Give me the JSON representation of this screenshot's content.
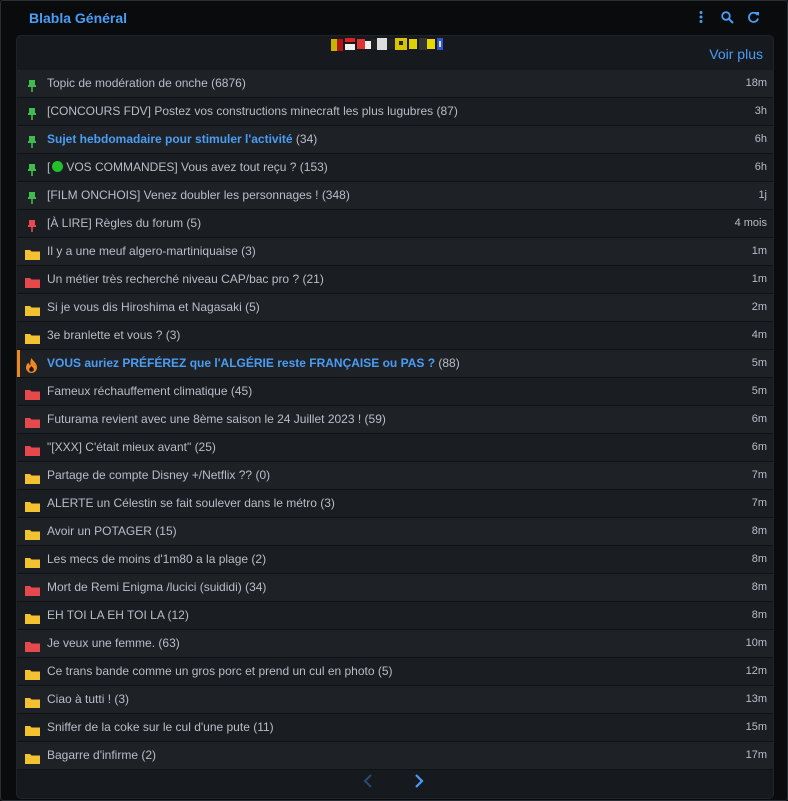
{
  "header": {
    "title": "Blabla Général",
    "icons": [
      "more-vertical-icon",
      "search-icon",
      "refresh-icon"
    ]
  },
  "panel": {
    "voir_plus": "Voir plus"
  },
  "colors": {
    "accent": "#4a9df5",
    "pin_green": "#3fb950",
    "pin_red": "#e5484d",
    "folder_yellow": "#f2c230",
    "folder_red": "#e5484d",
    "hot": "#f0881d",
    "green_dot": "#22c02a"
  },
  "topics": [
    {
      "icon": "pin-green",
      "title": "Topic de modération de onche",
      "count": "(6876)",
      "time": "18m",
      "highlight": false
    },
    {
      "icon": "pin-green",
      "title": "[CONCOURS FDV] Postez vos constructions minecraft les plus lugubres",
      "count": "(87)",
      "time": "3h",
      "highlight": false
    },
    {
      "icon": "pin-green",
      "title": "Sujet hebdomadaire pour stimuler l'activité",
      "count": "(34)",
      "time": "6h",
      "highlight": true
    },
    {
      "icon": "pin-green",
      "title_prefix": "[",
      "title": "VOS COMMANDES] Vous avez tout reçu ?",
      "count": "(153)",
      "time": "6h",
      "highlight": false,
      "dot": true
    },
    {
      "icon": "pin-green",
      "title": "[FILM ONCHOIS] Venez doubler les personnages !",
      "count": "(348)",
      "time": "1j",
      "highlight": false
    },
    {
      "icon": "pin-red",
      "title": "[À LIRE] Règles du forum",
      "count": "(5)",
      "time": "4 mois",
      "highlight": false
    },
    {
      "icon": "folder-yellow",
      "title": "Il y a une meuf algero-martiniquaise",
      "count": "(3)",
      "time": "1m",
      "highlight": false
    },
    {
      "icon": "folder-red",
      "title": "Un métier très recherché niveau CAP/bac pro ?",
      "count": "(21)",
      "time": "1m",
      "highlight": false
    },
    {
      "icon": "folder-yellow",
      "title": "Si je vous dis Hiroshima et Nagasaki",
      "count": "(5)",
      "time": "2m",
      "highlight": false
    },
    {
      "icon": "folder-yellow",
      "title": "3e branlette et vous ?",
      "count": "(3)",
      "time": "4m",
      "highlight": false
    },
    {
      "icon": "flame",
      "title": "VOUS auriez PRÉFÉREZ que l'ALGÉRIE reste FRANÇAISE ou PAS ?",
      "count": "(88)",
      "time": "5m",
      "highlight": true,
      "hot": true
    },
    {
      "icon": "folder-red",
      "title": "Fameux réchauffement climatique",
      "count": "(45)",
      "time": "5m",
      "highlight": false
    },
    {
      "icon": "folder-red",
      "title": "Futurama revient avec une 8ème saison le 24 Juillet 2023 !",
      "count": "(59)",
      "time": "6m",
      "highlight": false
    },
    {
      "icon": "folder-red",
      "title": "\"[XXX] C'était mieux avant\"",
      "count": "(25)",
      "time": "6m",
      "highlight": false
    },
    {
      "icon": "folder-yellow",
      "title": "Partage de compte Disney +/Netflix ??",
      "count": "(0)",
      "time": "7m",
      "highlight": false
    },
    {
      "icon": "folder-yellow",
      "title": "ALERTE un Célestin se fait soulever dans le métro",
      "count": "(3)",
      "time": "7m",
      "highlight": false
    },
    {
      "icon": "folder-yellow",
      "title": "Avoir un POTAGER",
      "count": "(15)",
      "time": "8m",
      "highlight": false
    },
    {
      "icon": "folder-yellow",
      "title": "Les mecs de moins d'1m80 a la plage",
      "count": "(2)",
      "time": "8m",
      "highlight": false
    },
    {
      "icon": "folder-red",
      "title": "Mort de Remi Enigma /lucici (suididi)",
      "count": "(34)",
      "time": "8m",
      "highlight": false
    },
    {
      "icon": "folder-yellow",
      "title": "EH TOI LA EH TOI LA",
      "count": "(12)",
      "time": "8m",
      "highlight": false
    },
    {
      "icon": "folder-red",
      "title": "Je veux une femme.",
      "count": "(63)",
      "time": "10m",
      "highlight": false
    },
    {
      "icon": "folder-yellow",
      "title": "Ce trans bande comme un gros porc et prend un cul en photo",
      "count": "(5)",
      "time": "12m",
      "highlight": false
    },
    {
      "icon": "folder-yellow",
      "title": "Ciao à tutti !",
      "count": "(3)",
      "time": "13m",
      "highlight": false
    },
    {
      "icon": "folder-yellow",
      "title": "Sniffer de la coke sur le cul d'une pute",
      "count": "(11)",
      "time": "15m",
      "highlight": false
    },
    {
      "icon": "folder-yellow",
      "title": "Bagarre d'infirme",
      "count": "(2)",
      "time": "17m",
      "highlight": false
    }
  ],
  "pager": {
    "prev_icon": "chevron-left-icon",
    "next_icon": "chevron-right-icon"
  }
}
